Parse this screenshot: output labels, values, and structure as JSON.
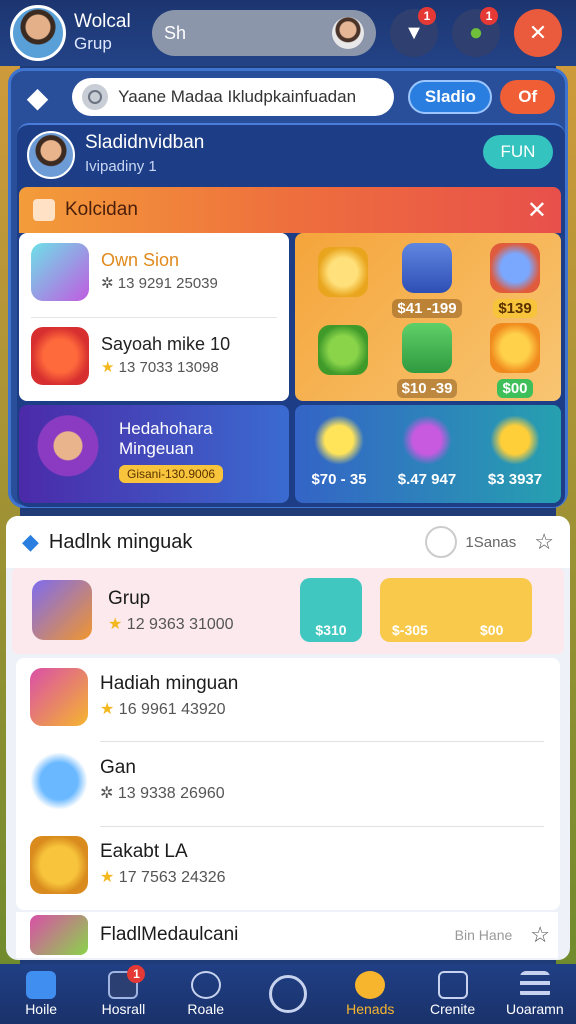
{
  "header": {
    "user_line1": "Wolcal",
    "user_line2": "Grup",
    "search_text": "Sh",
    "notif_badge": "1",
    "gift_badge": "1"
  },
  "bar": {
    "search_text": "Yaane Madaa Ikludpkainfuadan",
    "btn1": "Sladio",
    "btn2": "Of"
  },
  "profile": {
    "name": "Sladidnvidban",
    "level": "Ivipadiny 1",
    "fun": "FUN"
  },
  "section1": {
    "title": "Kolcidan",
    "items": [
      {
        "title": "Own Sion",
        "sub": "13 9291 25039"
      },
      {
        "title": "Sayoah mike 10",
        "sub": "13 7033 13098"
      }
    ],
    "grid": [
      "$41 -199",
      "$139",
      "$10 -39",
      "$00"
    ],
    "promo": {
      "line1": "Hedahohara",
      "line2": "Mingeuan",
      "chip": "Gisani-130.9006"
    },
    "promo2": [
      "$70 - 35",
      "$.47 947",
      "$3 3937"
    ]
  },
  "section2": {
    "title": "Hadlnk minguak",
    "sort": "1Sanas",
    "featured": {
      "title": "Grup",
      "sub": "12 9363 31000",
      "b1": "$310",
      "b2": "$-305",
      "b3": "$00"
    },
    "rows": [
      {
        "title": "Hadiah minguan",
        "sub": "16 9961 43920"
      },
      {
        "title": "Gan",
        "sub": "13 9338 26960"
      },
      {
        "title": "Eakabt LA",
        "sub": "17 7563 24326"
      },
      {
        "title": "FladlMedaulcani",
        "sub": "Bin Hane"
      }
    ]
  },
  "nav": [
    "Hoile",
    "Hosrall",
    "Roale",
    "",
    "Henads",
    "Crenite",
    "Uoaramn"
  ],
  "nav_badge": "1"
}
